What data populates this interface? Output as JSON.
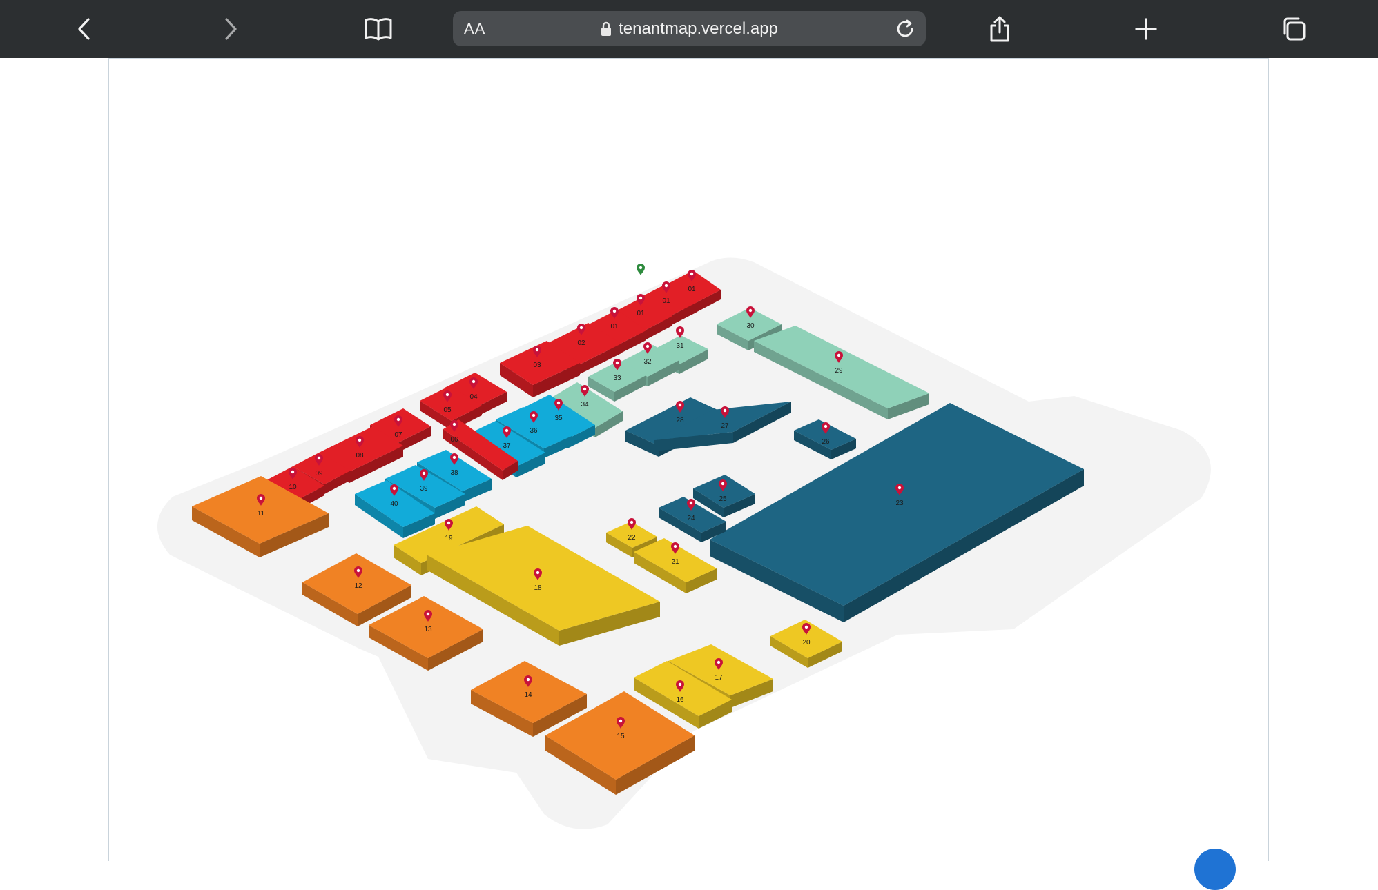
{
  "browser": {
    "text_size_label": "AA",
    "url": "tenantmap.vercel.app",
    "icons": {
      "back": "chevron-left-icon",
      "forward": "chevron-right-icon",
      "bookmarks": "book-icon",
      "lock": "lock-icon",
      "reload": "reload-icon",
      "share": "share-icon",
      "new_tab": "plus-icon",
      "tabs": "tabs-icon"
    }
  },
  "map": {
    "colors": {
      "red": "#e21f26",
      "mint": "#8fd1b8",
      "cyan": "#12abd9",
      "navy": "#1e6583",
      "yellow": "#eec823",
      "orange": "#f08224",
      "floor": "#f3f3f3",
      "pin": "#c8123a",
      "entrance_pin": "#2e8b3e"
    },
    "units": [
      {
        "id": "01a",
        "label": "01",
        "color": "red"
      },
      {
        "id": "01b",
        "label": "01",
        "color": "red"
      },
      {
        "id": "01c",
        "label": "01",
        "color": "red"
      },
      {
        "id": "01d",
        "label": "01",
        "color": "red"
      },
      {
        "id": "02",
        "label": "02",
        "color": "red"
      },
      {
        "id": "03",
        "label": "03",
        "color": "red"
      },
      {
        "id": "04",
        "label": "04",
        "color": "red"
      },
      {
        "id": "05",
        "label": "05",
        "color": "red"
      },
      {
        "id": "06",
        "label": "06",
        "color": "red"
      },
      {
        "id": "07",
        "label": "07",
        "color": "red"
      },
      {
        "id": "08",
        "label": "08",
        "color": "red"
      },
      {
        "id": "09",
        "label": "09",
        "color": "red"
      },
      {
        "id": "10",
        "label": "10",
        "color": "red"
      },
      {
        "id": "11",
        "label": "11",
        "color": "orange"
      },
      {
        "id": "12",
        "label": "12",
        "color": "orange"
      },
      {
        "id": "13",
        "label": "13",
        "color": "orange"
      },
      {
        "id": "14",
        "label": "14",
        "color": "orange"
      },
      {
        "id": "15",
        "label": "15",
        "color": "orange"
      },
      {
        "id": "16",
        "label": "16",
        "color": "yellow"
      },
      {
        "id": "17",
        "label": "17",
        "color": "yellow"
      },
      {
        "id": "18",
        "label": "18",
        "color": "yellow"
      },
      {
        "id": "19",
        "label": "19",
        "color": "yellow"
      },
      {
        "id": "20",
        "label": "20",
        "color": "yellow"
      },
      {
        "id": "21",
        "label": "21",
        "color": "yellow"
      },
      {
        "id": "22",
        "label": "22",
        "color": "yellow"
      },
      {
        "id": "23",
        "label": "23",
        "color": "navy"
      },
      {
        "id": "24",
        "label": "24",
        "color": "navy"
      },
      {
        "id": "25",
        "label": "25",
        "color": "navy"
      },
      {
        "id": "26",
        "label": "26",
        "color": "navy"
      },
      {
        "id": "27",
        "label": "27",
        "color": "navy"
      },
      {
        "id": "28",
        "label": "28",
        "color": "navy"
      },
      {
        "id": "29",
        "label": "29",
        "color": "mint"
      },
      {
        "id": "30",
        "label": "30",
        "color": "mint"
      },
      {
        "id": "31",
        "label": "31",
        "color": "mint"
      },
      {
        "id": "32",
        "label": "32",
        "color": "mint"
      },
      {
        "id": "33",
        "label": "33",
        "color": "mint"
      },
      {
        "id": "34",
        "label": "34",
        "color": "mint"
      },
      {
        "id": "35",
        "label": "35",
        "color": "cyan"
      },
      {
        "id": "36",
        "label": "36",
        "color": "cyan"
      },
      {
        "id": "37",
        "label": "37",
        "color": "cyan"
      },
      {
        "id": "38",
        "label": "38",
        "color": "cyan"
      },
      {
        "id": "39",
        "label": "39",
        "color": "cyan"
      },
      {
        "id": "40",
        "label": "40",
        "color": "cyan"
      }
    ]
  }
}
